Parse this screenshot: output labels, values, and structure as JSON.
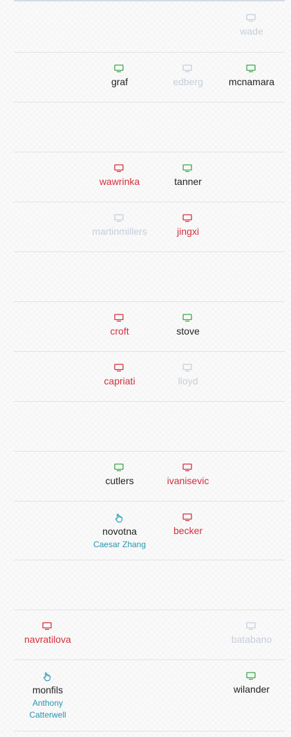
{
  "colors": {
    "online": "#3aa845",
    "offline": "#d32f3c",
    "unknown": "#c5cfdb",
    "occupied": "#2596b4"
  },
  "rows": [
    {
      "seats": [
        {
          "name": "wade",
          "status": "unknown",
          "icon": "monitor-icon"
        }
      ]
    },
    {
      "seats": [
        {
          "name": "graf",
          "status": "online",
          "icon": "monitor-icon"
        },
        {
          "name": "edberg",
          "status": "unknown",
          "icon": "monitor-icon"
        },
        {
          "name": "mcnamara",
          "status": "online",
          "icon": "monitor-icon"
        }
      ]
    },
    {
      "seats": []
    },
    {
      "seats": [
        {
          "name": "wawrinka",
          "status": "offline",
          "icon": "monitor-icon"
        },
        {
          "name": "tanner",
          "status": "online",
          "icon": "monitor-icon"
        }
      ]
    },
    {
      "seats": [
        {
          "name": "martinmillers",
          "status": "unknown",
          "icon": "monitor-icon"
        },
        {
          "name": "jingxi",
          "status": "offline",
          "icon": "monitor-icon"
        }
      ]
    },
    {
      "seats": []
    },
    {
      "seats": [
        {
          "name": "croft",
          "status": "offline",
          "icon": "monitor-icon"
        },
        {
          "name": "stove",
          "status": "online",
          "icon": "monitor-icon"
        }
      ]
    },
    {
      "seats": [
        {
          "name": "capriati",
          "status": "offline",
          "icon": "monitor-icon"
        },
        {
          "name": "lloyd",
          "status": "unknown",
          "icon": "monitor-icon"
        }
      ]
    },
    {
      "seats": []
    },
    {
      "seats": [
        {
          "name": "cutlers",
          "status": "online",
          "icon": "monitor-icon"
        },
        {
          "name": "ivanisevic",
          "status": "offline",
          "icon": "monitor-icon"
        }
      ]
    },
    {
      "seats": [
        {
          "name": "novotna",
          "status": "occupied",
          "icon": "hand-icon",
          "user": "Caesar Zhang"
        },
        {
          "name": "becker",
          "status": "offline",
          "icon": "monitor-icon"
        }
      ]
    },
    {
      "seats": []
    },
    {
      "seats": [
        {
          "name": "navratilova",
          "status": "offline",
          "icon": "monitor-icon"
        },
        {
          "name": "batabano",
          "status": "unknown",
          "icon": "monitor-icon"
        }
      ]
    },
    {
      "seats": [
        {
          "name": "monfils",
          "status": "occupied",
          "icon": "hand-icon",
          "user": "Anthony Catterwell"
        },
        {
          "name": "wilander",
          "status": "online",
          "icon": "monitor-icon"
        }
      ]
    }
  ]
}
